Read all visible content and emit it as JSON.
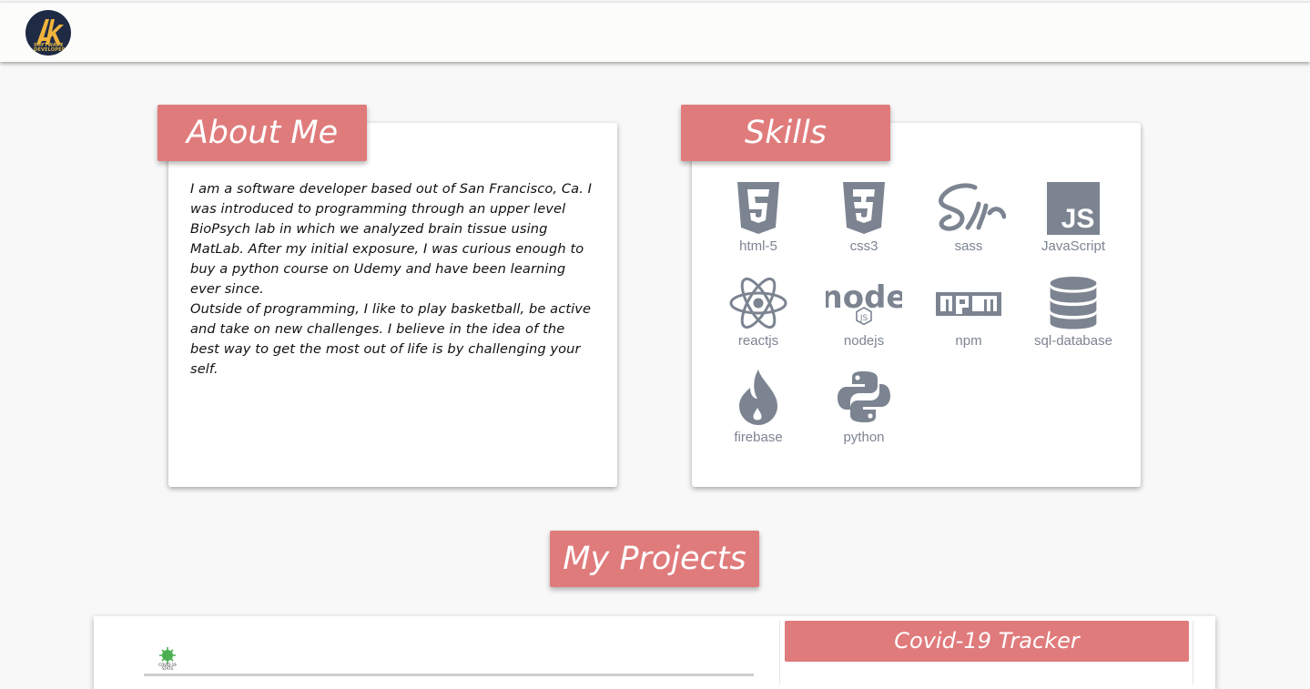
{
  "logo": {
    "initials": "Ak",
    "subtitle": "SOFTWARE DEVELOPER"
  },
  "about": {
    "heading": "About Me",
    "paragraph1": "I am a software developer based out of San Francisco, Ca. I was introduced to programming through an upper level BioPsych lab in which we analyzed brain tissue using MatLab. After my initial exposure, I was curious enough to buy a python course on Udemy and have been learning ever since.",
    "paragraph2": "Outside of programming, I like to play basketball, be active and take on new challenges. I believe in the idea of the best way to get the most out of life is by challenging your self."
  },
  "skills": {
    "heading": "Skills",
    "items": [
      {
        "label": "html-5",
        "icon": "html5-icon"
      },
      {
        "label": "css3",
        "icon": "css3-icon"
      },
      {
        "label": "sass",
        "icon": "sass-icon"
      },
      {
        "label": "JavaScript",
        "icon": "javascript-icon"
      },
      {
        "label": "reactjs",
        "icon": "react-icon"
      },
      {
        "label": "nodejs",
        "icon": "nodejs-icon"
      },
      {
        "label": "npm",
        "icon": "npm-icon"
      },
      {
        "label": "sql-database",
        "icon": "database-icon"
      },
      {
        "label": "firebase",
        "icon": "firebase-icon"
      },
      {
        "label": "python",
        "icon": "python-icon"
      }
    ]
  },
  "projects": {
    "heading": "My Projects",
    "items": [
      {
        "title": "Covid-19 Tracker",
        "thumbnail_caption": "COVID-19 STATS"
      }
    ]
  },
  "colors": {
    "accent": "#e07b7c",
    "icon_gray": "#7c8491",
    "background": "#f8f8f8"
  }
}
